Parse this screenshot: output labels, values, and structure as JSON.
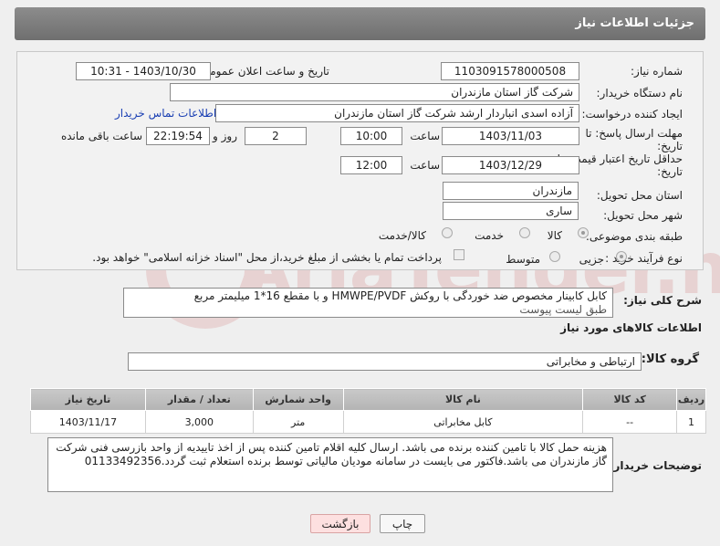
{
  "header": {
    "title": "جزئیات اطلاعات نیاز"
  },
  "form": {
    "need_number_label": "شماره نیاز:",
    "need_number": "1103091578000508",
    "announce_label": "تاریخ و ساعت اعلان عمومی:",
    "announce_value": "1403/10/30 - 10:31",
    "buyer_org_label": "نام دستگاه خریدار:",
    "buyer_org": "شرکت گاز استان مازندران",
    "creator_label": "ایجاد کننده درخواست:",
    "creator": "آزاده اسدی انباردار ارشد شرکت گاز استان مازندران",
    "contact_link": "اطلاعات تماس خریدار",
    "deadline_label_1": "مهلت ارسال پاسخ: تا",
    "deadline_label_2": "تاریخ:",
    "deadline_date": "1403/11/03",
    "time_label": "ساعت",
    "deadline_time": "10:00",
    "days_value": "2",
    "days_label": "روز و",
    "remaining_time": "22:19:54",
    "remaining_label": "ساعت باقی مانده",
    "validity_label_1": "حداقل تاریخ اعتبار قیمت: تا",
    "validity_label_2": "تاریخ:",
    "validity_date": "1403/12/29",
    "validity_time": "12:00",
    "province_label": "استان محل تحویل:",
    "province": "مازندران",
    "city_label": "شهر محل تحویل:",
    "city": "ساری",
    "category_label": "طبقه بندی موضوعی:",
    "category_options": [
      "کالا",
      "خدمت",
      "کالا/خدمت"
    ],
    "process_label": "نوع فرآیند خرید :",
    "process_options": [
      "جزیی",
      "متوسط"
    ],
    "treasury_note": "پرداخت تمام یا بخشی از مبلغ خرید،از محل \"اسناد خزانه اسلامی\" خواهد بود."
  },
  "description": {
    "label": "شرح کلی نیاز:",
    "text_line1": "کابل کابینار مخصوص ضد خوردگی با روکش HMWPE/PVDF و با مقطع 16*1 میلیمتر مربع",
    "text_line2": "طبق لیست پیوست"
  },
  "goods": {
    "section_title": "اطلاعات کالاهای مورد نیاز",
    "group_label": "گروه کالا:",
    "group_value": "ارتباطی و مخابراتی",
    "table": {
      "headers": [
        "ردیف",
        "کد کالا",
        "نام کالا",
        "واحد شمارش",
        "تعداد / مقدار",
        "تاریخ نیاز"
      ],
      "rows": [
        [
          "1",
          "--",
          "کابل مخابراتی",
          "متر",
          "3,000",
          "1403/11/17"
        ]
      ]
    }
  },
  "buyer_notes": {
    "label": "توضیحات خریدار:",
    "text": "هزینه حمل کالا با تامین کننده برنده می باشد. ارسال کلیه اقلام تامین کننده پس از اخذ تاییدیه از واحد بازرسی فنی شرکت گاز مازندران می باشد.فاکتور می بایست در سامانه مودیان مالیاتی توسط برنده استعلام ثبت گردد.01133492356"
  },
  "buttons": {
    "print": "چاپ",
    "back": "بازگشت"
  },
  "watermark_text": "AriaTender.net"
}
